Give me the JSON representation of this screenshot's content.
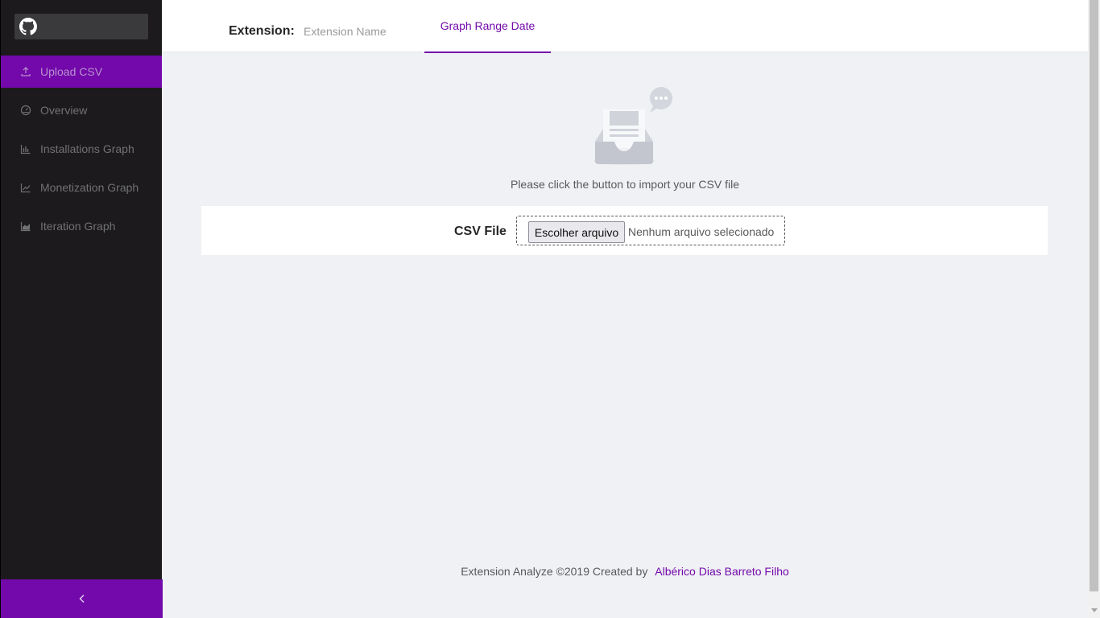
{
  "sidebar": {
    "logo_icon": "github-icon",
    "items": [
      {
        "label": "Upload CSV",
        "icon": "upload-icon",
        "active": true
      },
      {
        "label": "Overview",
        "icon": "dashboard-icon",
        "active": false
      },
      {
        "label": "Installations Graph",
        "icon": "bar-chart-icon",
        "active": false
      },
      {
        "label": "Monetization Graph",
        "icon": "line-chart-icon",
        "active": false
      },
      {
        "label": "Iteration Graph",
        "icon": "area-chart-icon",
        "active": false
      }
    ],
    "collapse_icon": "chevron-left-icon"
  },
  "header": {
    "extension_label": "Extension:",
    "extension_placeholder": "Extension Name",
    "extension_value": "",
    "tab_label": "Graph Range Date"
  },
  "main": {
    "empty_icon": "empty-inbox-icon",
    "import_text": "Please click the button to import your CSV file",
    "csv_label": "CSV File",
    "file_button_label": "Escolher arquivo",
    "file_status": "Nenhum arquivo selecionado"
  },
  "footer": {
    "text": "Extension Analyze ©2019 Created by",
    "author": "Albérico Dias Barreto Filho"
  },
  "colors": {
    "accent": "#7309aa",
    "sidebar_bg": "#1c1a1d",
    "content_bg": "#f0f1f5"
  }
}
